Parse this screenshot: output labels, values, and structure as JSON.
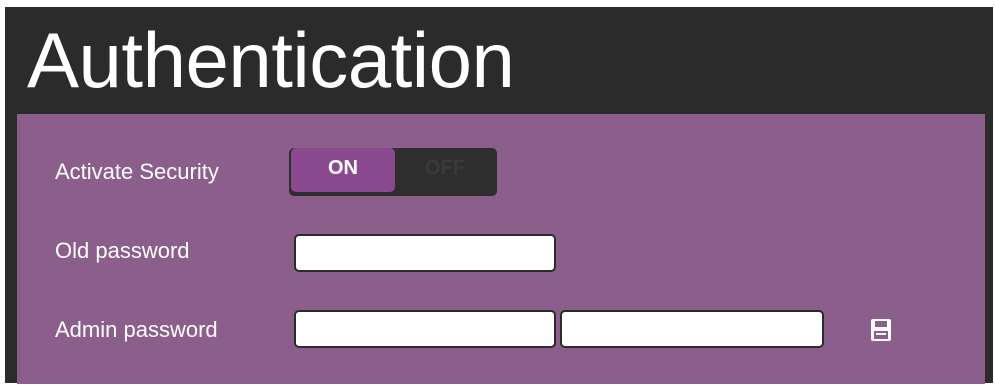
{
  "header": {
    "title": "Authentication"
  },
  "security": {
    "label": "Activate Security",
    "on_label": "ON",
    "off_label": "OFF",
    "state": "ON"
  },
  "old_password": {
    "label": "Old password",
    "value": ""
  },
  "admin_password": {
    "label": "Admin password",
    "value": "",
    "confirm_value": ""
  },
  "icons": {
    "save": "save-icon"
  },
  "colors": {
    "header_bg": "#2b2b2b",
    "panel_bg": "#8b5e8c",
    "toggle_on": "#8b4a90",
    "save_icon": "#ffffff"
  }
}
